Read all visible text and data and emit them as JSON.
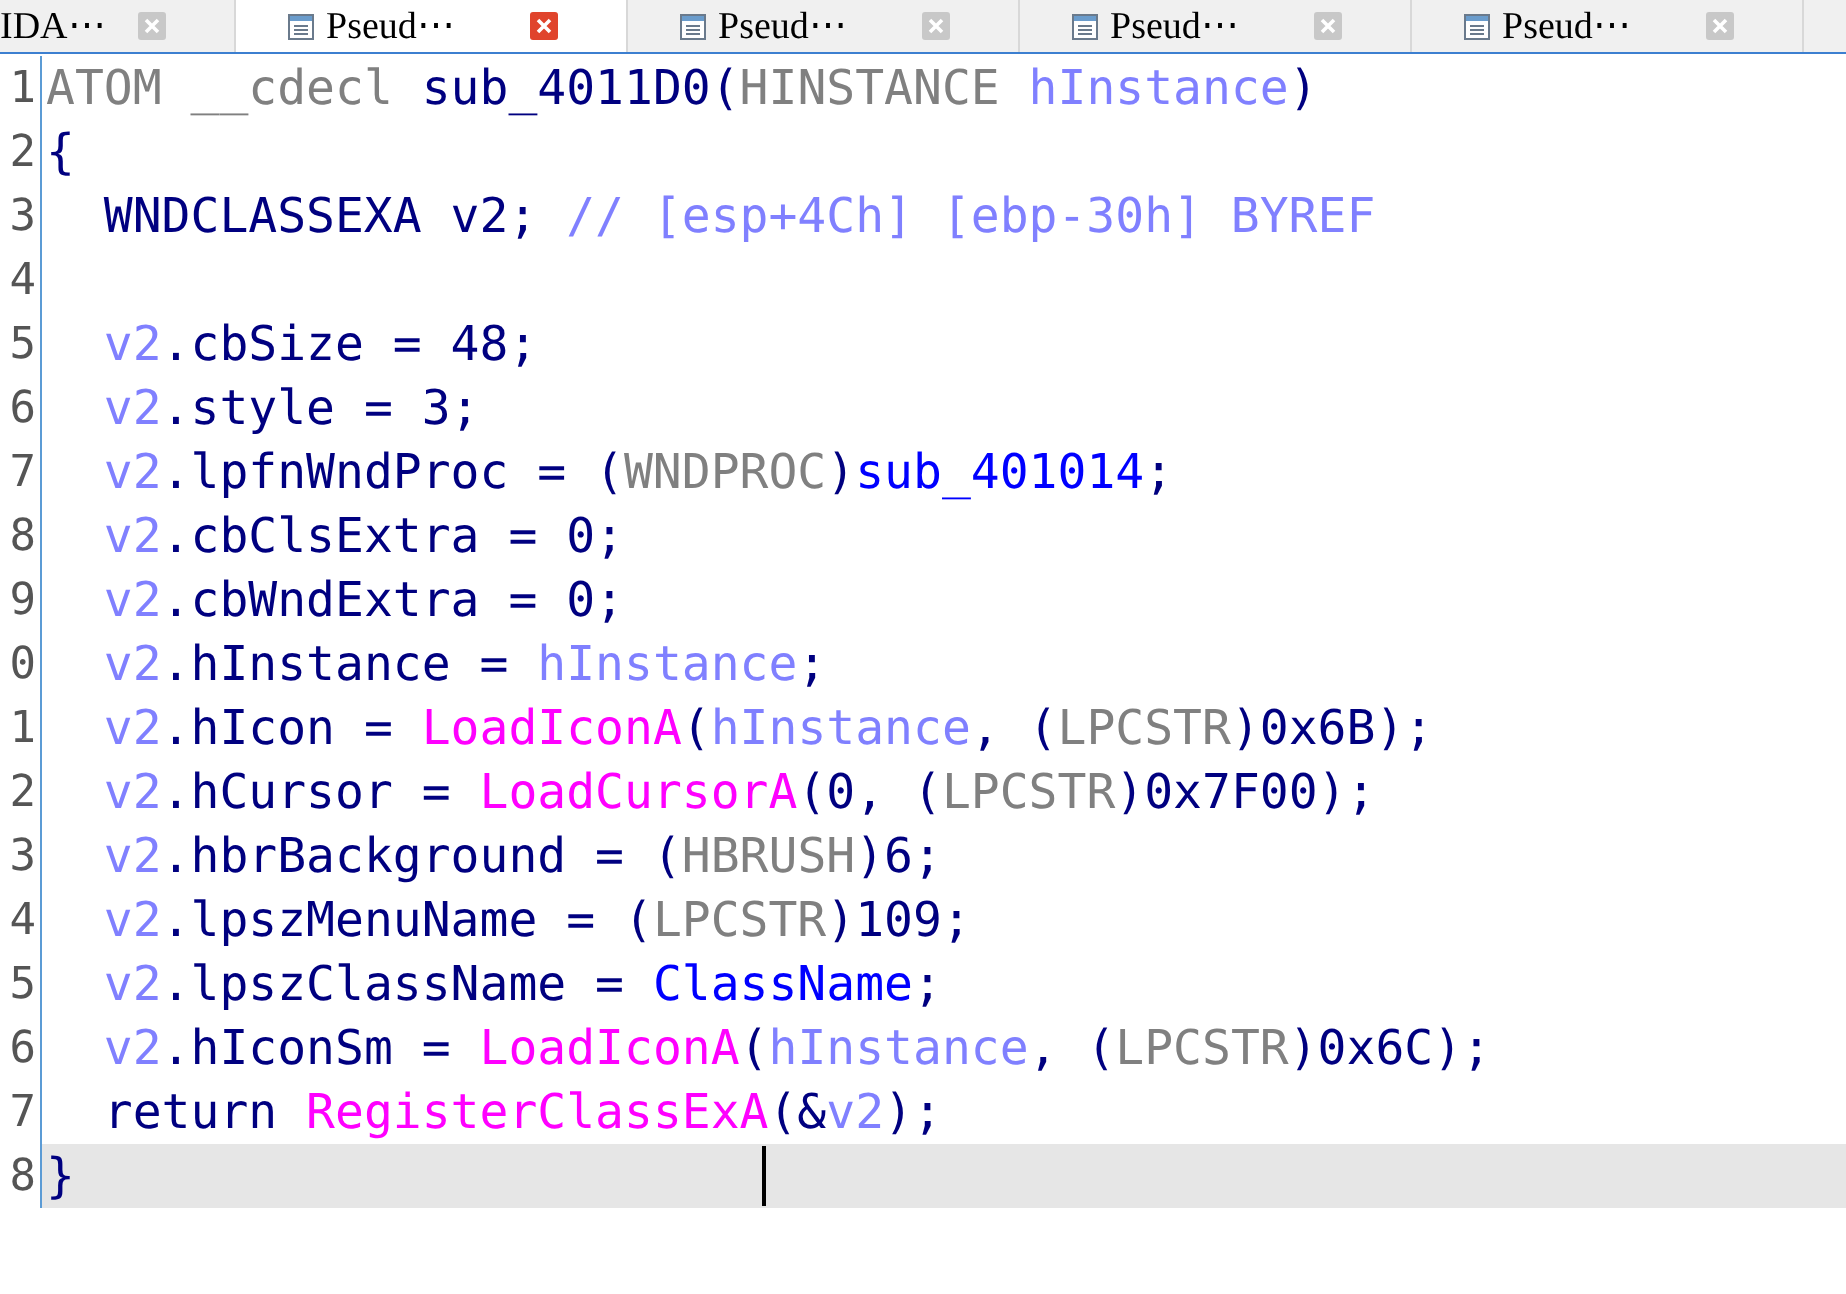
{
  "tabs": [
    {
      "label": "IDA⋯",
      "kind": "ida",
      "selected": false
    },
    {
      "label": "Pseud⋯",
      "kind": "pseudo",
      "selected": true
    },
    {
      "label": "Pseud⋯",
      "kind": "pseudo",
      "selected": false
    },
    {
      "label": "Pseud⋯",
      "kind": "pseudo",
      "selected": false
    },
    {
      "label": "Pseud⋯",
      "kind": "pseudo",
      "selected": false
    }
  ],
  "code": {
    "lines": [
      {
        "number": "1",
        "current": false,
        "indented": false,
        "tokens": [
          {
            "kind": "type",
            "text": "ATOM __cdecl "
          },
          {
            "kind": "plain",
            "text": "sub_4011D0("
          },
          {
            "kind": "type",
            "text": "HINSTANCE "
          },
          {
            "kind": "local",
            "text": "hInstance"
          },
          {
            "kind": "plain",
            "text": ")"
          }
        ]
      },
      {
        "number": "2",
        "current": false,
        "indented": false,
        "tokens": [
          {
            "kind": "plain",
            "text": "{"
          }
        ]
      },
      {
        "number": "3",
        "current": false,
        "indented": true,
        "tokens": [
          {
            "kind": "plain",
            "text": "WNDCLASSEXA v2; "
          },
          {
            "kind": "comment",
            "text": "// [esp+4Ch] [ebp-30h] BYREF"
          }
        ]
      },
      {
        "number": "4",
        "current": false
      },
      {
        "number": "5",
        "current": false,
        "indented": true,
        "tokens": [
          {
            "kind": "local",
            "text": "v2"
          },
          {
            "kind": "plain",
            "text": ".cbSize = 48;"
          }
        ]
      },
      {
        "number": "6",
        "current": false,
        "indented": true,
        "tokens": [
          {
            "kind": "local",
            "text": "v2"
          },
          {
            "kind": "plain",
            "text": ".style = 3;"
          }
        ]
      },
      {
        "number": "7",
        "current": false,
        "indented": true,
        "tokens": [
          {
            "kind": "local",
            "text": "v2"
          },
          {
            "kind": "plain",
            "text": ".lpfnWndProc = ("
          },
          {
            "kind": "type",
            "text": "WNDPROC"
          },
          {
            "kind": "plain",
            "text": ")"
          },
          {
            "kind": "name",
            "text": "sub_401014"
          },
          {
            "kind": "plain",
            "text": ";"
          }
        ]
      },
      {
        "number": "8",
        "current": false,
        "indented": true,
        "tokens": [
          {
            "kind": "local",
            "text": "v2"
          },
          {
            "kind": "plain",
            "text": ".cbClsExtra = 0;"
          }
        ]
      },
      {
        "number": "9",
        "current": false,
        "indented": true,
        "tokens": [
          {
            "kind": "local",
            "text": "v2"
          },
          {
            "kind": "plain",
            "text": ".cbWndExtra = 0;"
          }
        ]
      },
      {
        "number": "0",
        "current": false,
        "indented": true,
        "tokens": [
          {
            "kind": "local",
            "text": "v2"
          },
          {
            "kind": "plain",
            "text": ".hInstance = "
          },
          {
            "kind": "local",
            "text": "hInstance"
          },
          {
            "kind": "plain",
            "text": ";"
          }
        ]
      },
      {
        "number": "1",
        "current": false,
        "indented": true,
        "tokens": [
          {
            "kind": "local",
            "text": "v2"
          },
          {
            "kind": "plain",
            "text": ".hIcon = "
          },
          {
            "kind": "func",
            "text": "LoadIconA"
          },
          {
            "kind": "plain",
            "text": "("
          },
          {
            "kind": "local",
            "text": "hInstance"
          },
          {
            "kind": "plain",
            "text": ", ("
          },
          {
            "kind": "type",
            "text": "LPCSTR"
          },
          {
            "kind": "plain",
            "text": ")0x6B);"
          }
        ]
      },
      {
        "number": "2",
        "current": false,
        "indented": true,
        "tokens": [
          {
            "kind": "local",
            "text": "v2"
          },
          {
            "kind": "plain",
            "text": ".hCursor = "
          },
          {
            "kind": "func",
            "text": "LoadCursorA"
          },
          {
            "kind": "plain",
            "text": "(0, ("
          },
          {
            "kind": "type",
            "text": "LPCSTR"
          },
          {
            "kind": "plain",
            "text": ")0x7F00);"
          }
        ]
      },
      {
        "number": "3",
        "current": false,
        "indented": true,
        "tokens": [
          {
            "kind": "local",
            "text": "v2"
          },
          {
            "kind": "plain",
            "text": ".hbrBackground = ("
          },
          {
            "kind": "type",
            "text": "HBRUSH"
          },
          {
            "kind": "plain",
            "text": ")6;"
          }
        ]
      },
      {
        "number": "4",
        "current": false,
        "indented": true,
        "tokens": [
          {
            "kind": "local",
            "text": "v2"
          },
          {
            "kind": "plain",
            "text": ".lpszMenuName = ("
          },
          {
            "kind": "type",
            "text": "LPCSTR"
          },
          {
            "kind": "plain",
            "text": ")109;"
          }
        ]
      },
      {
        "number": "5",
        "current": false,
        "indented": true,
        "tokens": [
          {
            "kind": "local",
            "text": "v2"
          },
          {
            "kind": "plain",
            "text": ".lpszClassName = "
          },
          {
            "kind": "name",
            "text": "ClassName"
          },
          {
            "kind": "plain",
            "text": ";"
          }
        ]
      },
      {
        "number": "6",
        "current": false,
        "indented": true,
        "tokens": [
          {
            "kind": "local",
            "text": "v2"
          },
          {
            "kind": "plain",
            "text": ".hIconSm = "
          },
          {
            "kind": "func",
            "text": "LoadIconA"
          },
          {
            "kind": "plain",
            "text": "("
          },
          {
            "kind": "local",
            "text": "hInstance"
          },
          {
            "kind": "plain",
            "text": ", ("
          },
          {
            "kind": "type",
            "text": "LPCSTR"
          },
          {
            "kind": "plain",
            "text": ")0x6C);"
          }
        ]
      },
      {
        "number": "7",
        "current": false,
        "indented": true,
        "tokens": [
          {
            "kind": "plain",
            "text": "return "
          },
          {
            "kind": "func",
            "text": "RegisterClassExA"
          },
          {
            "kind": "plain",
            "text": "(&"
          },
          {
            "kind": "local",
            "text": "v2"
          },
          {
            "kind": "plain",
            "text": ");"
          }
        ]
      },
      {
        "number": "8",
        "current": true,
        "indented": false,
        "tokens": [
          {
            "kind": "plain",
            "text": "}"
          }
        ]
      }
    ]
  }
}
